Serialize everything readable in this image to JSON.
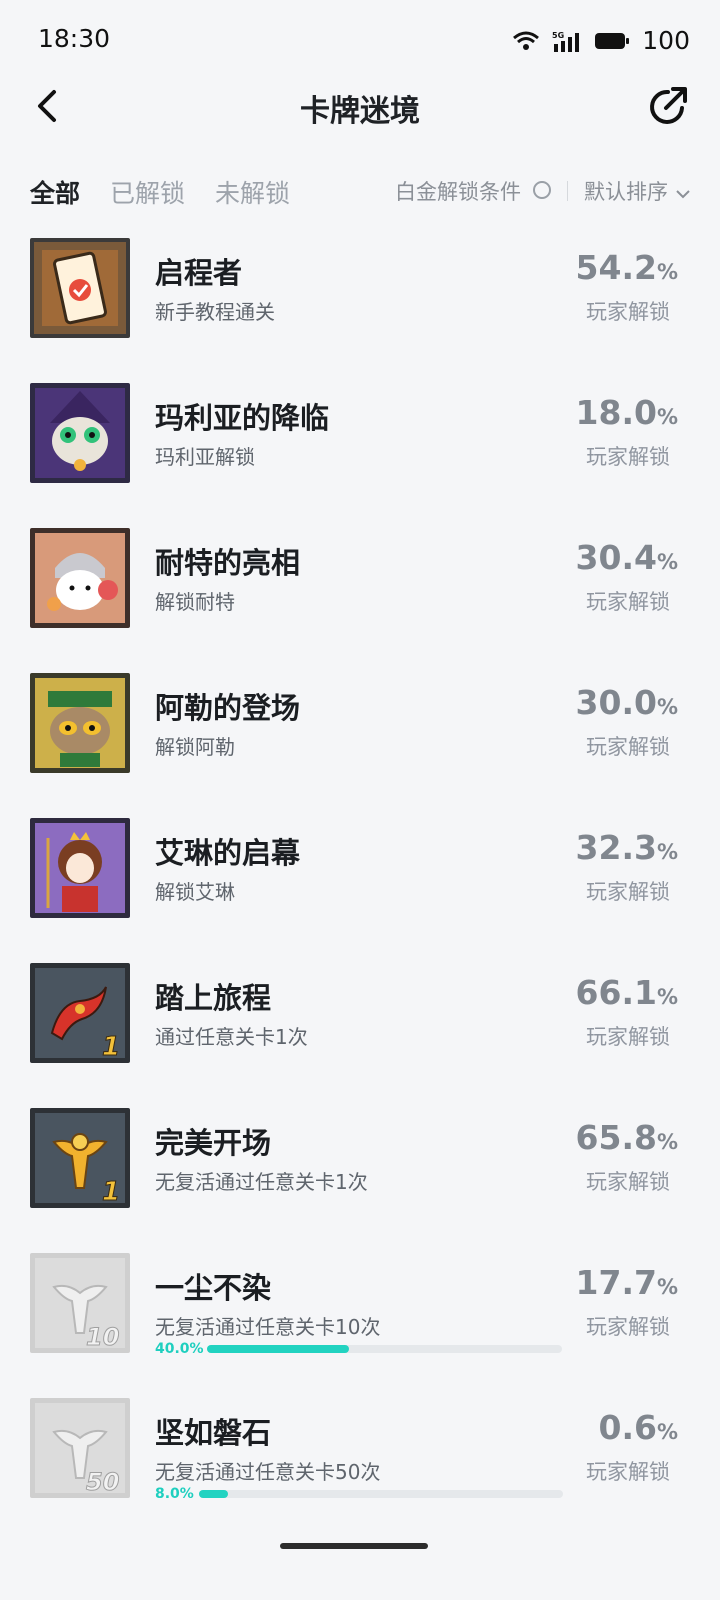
{
  "status": {
    "time": "18:30",
    "battery": "100",
    "network": "5G"
  },
  "header": {
    "title": "卡牌迷境",
    "back_icon": "chevron-left-icon",
    "share_icon": "share-icon"
  },
  "tabs": [
    {
      "label": "全部",
      "active": true
    },
    {
      "label": "已解锁",
      "active": false
    },
    {
      "label": "未解锁",
      "active": false
    }
  ],
  "filters": {
    "platinum_label": "白金解锁条件",
    "sort_label": "默认排序"
  },
  "unlock_label": "玩家解锁",
  "achievements": [
    {
      "name": "启程者",
      "desc": "新手教程通关",
      "percent": "54.2",
      "unit": "%",
      "icon": "clipboard-icon",
      "locked": false
    },
    {
      "name": "玛利亚的降临",
      "desc": "玛利亚解锁",
      "percent": "18.0",
      "unit": "%",
      "icon": "witch-cat-icon",
      "locked": false
    },
    {
      "name": "耐特的亮相",
      "desc": "解锁耐特",
      "percent": "30.4",
      "unit": "%",
      "icon": "knight-cat-icon",
      "locked": false
    },
    {
      "name": "阿勒的登场",
      "desc": "解锁阿勒",
      "percent": "30.0",
      "unit": "%",
      "icon": "green-hat-cat-icon",
      "locked": false
    },
    {
      "name": "艾琳的启幕",
      "desc": "解锁艾琳",
      "percent": "32.3",
      "unit": "%",
      "icon": "queen-icon",
      "locked": false
    },
    {
      "name": "踏上旅程",
      "desc": "通过任意关卡1次",
      "percent": "66.1",
      "unit": "%",
      "icon": "flag-icon",
      "badge": "1",
      "locked": false
    },
    {
      "name": "完美开场",
      "desc": "无复活通过任意关卡1次",
      "percent": "65.8",
      "unit": "%",
      "icon": "golden-trophy-icon",
      "badge": "1",
      "locked": false
    },
    {
      "name": "一尘不染",
      "desc": "无复活通过任意关卡10次",
      "percent": "17.7",
      "unit": "%",
      "icon": "gray-trophy-icon",
      "badge": "10",
      "locked": true,
      "progress_text": "40.0%",
      "progress": 0.4
    },
    {
      "name": "坚如磐石",
      "desc": "无复活通过任意关卡50次",
      "percent": "0.6",
      "unit": "%",
      "icon": "gray-trophy-icon",
      "badge": "50",
      "locked": true,
      "progress_text": "8.0%",
      "progress": 0.08
    }
  ]
}
